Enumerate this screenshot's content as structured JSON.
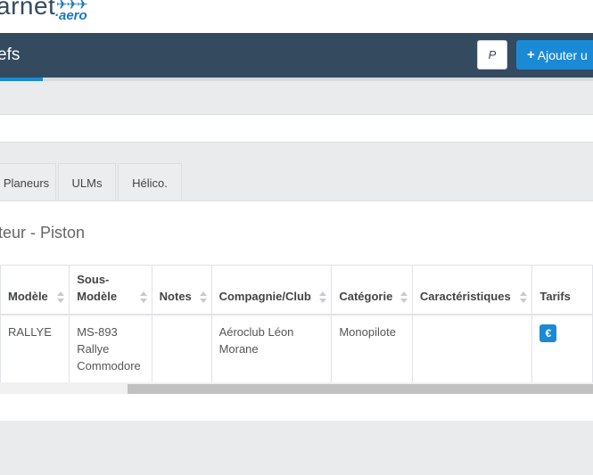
{
  "logo": {
    "text": "arnet",
    "birds": "✈✈✈",
    "sub": "·aero"
  },
  "nav": {
    "title": "efs",
    "icon_button": "P",
    "add_label": "Ajouter u"
  },
  "tabs": [
    {
      "label": "Planeurs"
    },
    {
      "label": "ULMs"
    },
    {
      "label": "Hélico."
    }
  ],
  "section": {
    "title": "teur - Piston"
  },
  "table": {
    "headers": [
      "Modèle",
      "Sous-Modèle",
      "Notes",
      "Compagnie/Club",
      "Catégorie",
      "Caractéristiques",
      "Tarifs"
    ],
    "rows": [
      {
        "modele": "RALLYE",
        "sous_modele": "MS-893 Rallye Commodore",
        "notes": "",
        "compagnie": "Aéroclub Léon Morane",
        "categorie": "Monopilote",
        "caracteristiques": "",
        "tarifs_icon": "€"
      }
    ]
  }
}
